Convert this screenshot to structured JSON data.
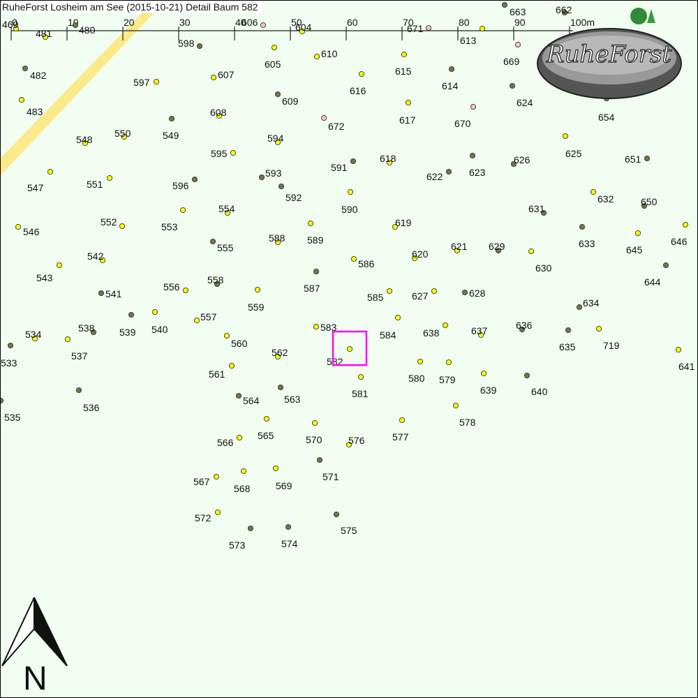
{
  "title": "RuheForst Losheim am See (2015-10-21) Detail  Baum 582",
  "selected_tree": "582",
  "logo_text": "RuheForst",
  "north_label": "N",
  "scale": {
    "labels": [
      "0",
      "10",
      "20",
      "30",
      "40",
      "50",
      "60",
      "70",
      "80",
      "90",
      "100m"
    ],
    "unit": "m",
    "max": 100
  },
  "colors": {
    "background": "#f0fdf0",
    "path": "#fbe98a",
    "tree_available": "#ffff00",
    "tree_occupied": "#757545",
    "tree_reserved": "#ffc0cb",
    "highlight": "#ff00ff"
  },
  "legend_meaning": {
    "available": "yellow",
    "occupied": "olive",
    "reserved": "pink"
  },
  "trees": [
    {
      "id": "469",
      "status": "available"
    },
    {
      "id": "481",
      "status": "available"
    },
    {
      "id": "480",
      "status": "occupied"
    },
    {
      "id": "482",
      "status": "occupied"
    },
    {
      "id": "483",
      "status": "available"
    },
    {
      "id": "598",
      "status": "occupied"
    },
    {
      "id": "606",
      "status": "reserved"
    },
    {
      "id": "604",
      "status": "available"
    },
    {
      "id": "605",
      "status": "available"
    },
    {
      "id": "610",
      "status": "available"
    },
    {
      "id": "607",
      "status": "available"
    },
    {
      "id": "597",
      "status": "available"
    },
    {
      "id": "609",
      "status": "occupied"
    },
    {
      "id": "608",
      "status": "available"
    },
    {
      "id": "672",
      "status": "reserved"
    },
    {
      "id": "671",
      "status": "reserved"
    },
    {
      "id": "613",
      "status": "available"
    },
    {
      "id": "663",
      "status": "occupied"
    },
    {
      "id": "662",
      "status": "occupied"
    },
    {
      "id": "669",
      "status": "reserved"
    },
    {
      "id": "615",
      "status": "available"
    },
    {
      "id": "616",
      "status": "available"
    },
    {
      "id": "614",
      "status": "occupied"
    },
    {
      "id": "624",
      "status": "occupied"
    },
    {
      "id": "617",
      "status": "available"
    },
    {
      "id": "670",
      "status": "reserved"
    },
    {
      "id": "654",
      "status": "occupied"
    },
    {
      "id": "549",
      "status": "occupied"
    },
    {
      "id": "550",
      "status": "available"
    },
    {
      "id": "548",
      "status": "available"
    },
    {
      "id": "595",
      "status": "available"
    },
    {
      "id": "594",
      "status": "available"
    },
    {
      "id": "547",
      "status": "available"
    },
    {
      "id": "551",
      "status": "available"
    },
    {
      "id": "596",
      "status": "occupied"
    },
    {
      "id": "593",
      "status": "occupied"
    },
    {
      "id": "591",
      "status": "occupied"
    },
    {
      "id": "618",
      "status": "available"
    },
    {
      "id": "622",
      "status": "occupied"
    },
    {
      "id": "623",
      "status": "occupied"
    },
    {
      "id": "626",
      "status": "occupied"
    },
    {
      "id": "625",
      "status": "available"
    },
    {
      "id": "651",
      "status": "occupied"
    },
    {
      "id": "592",
      "status": "occupied"
    },
    {
      "id": "590",
      "status": "available"
    },
    {
      "id": "632",
      "status": "available"
    },
    {
      "id": "650",
      "status": "occupied"
    },
    {
      "id": "554",
      "status": "available"
    },
    {
      "id": "553",
      "status": "available"
    },
    {
      "id": "552",
      "status": "available"
    },
    {
      "id": "546",
      "status": "available"
    },
    {
      "id": "589",
      "status": "available"
    },
    {
      "id": "588",
      "status": "available"
    },
    {
      "id": "555",
      "status": "occupied"
    },
    {
      "id": "619",
      "status": "available"
    },
    {
      "id": "631",
      "status": "occupied"
    },
    {
      "id": "633",
      "status": "occupied"
    },
    {
      "id": "645",
      "status": "available"
    },
    {
      "id": "646",
      "status": "available"
    },
    {
      "id": "542",
      "status": "available"
    },
    {
      "id": "543",
      "status": "available"
    },
    {
      "id": "586",
      "status": "available"
    },
    {
      "id": "620",
      "status": "available"
    },
    {
      "id": "621",
      "status": "available"
    },
    {
      "id": "629",
      "status": "occupied"
    },
    {
      "id": "630",
      "status": "available"
    },
    {
      "id": "587",
      "status": "occupied"
    },
    {
      "id": "558",
      "status": "occupied"
    },
    {
      "id": "556",
      "status": "available"
    },
    {
      "id": "541",
      "status": "occupied"
    },
    {
      "id": "644",
      "status": "occupied"
    },
    {
      "id": "559",
      "status": "available"
    },
    {
      "id": "585",
      "status": "available"
    },
    {
      "id": "627",
      "status": "available"
    },
    {
      "id": "628",
      "status": "occupied"
    },
    {
      "id": "634",
      "status": "occupied"
    },
    {
      "id": "557",
      "status": "available"
    },
    {
      "id": "538",
      "status": "occupied"
    },
    {
      "id": "539",
      "status": "occupied"
    },
    {
      "id": "540",
      "status": "available"
    },
    {
      "id": "583",
      "status": "available"
    },
    {
      "id": "584",
      "status": "available"
    },
    {
      "id": "638",
      "status": "available"
    },
    {
      "id": "637",
      "status": "available"
    },
    {
      "id": "636",
      "status": "occupied"
    },
    {
      "id": "635",
      "status": "occupied"
    },
    {
      "id": "719",
      "status": "available"
    },
    {
      "id": "534",
      "status": "available"
    },
    {
      "id": "537",
      "status": "available"
    },
    {
      "id": "560",
      "status": "available"
    },
    {
      "id": "562",
      "status": "available"
    },
    {
      "id": "582",
      "status": "available"
    },
    {
      "id": "533",
      "status": "occupied"
    },
    {
      "id": "641",
      "status": "available"
    },
    {
      "id": "561",
      "status": "available"
    },
    {
      "id": "580",
      "status": "available"
    },
    {
      "id": "579",
      "status": "available"
    },
    {
      "id": "581",
      "status": "available"
    },
    {
      "id": "639",
      "status": "available"
    },
    {
      "id": "640",
      "status": "occupied"
    },
    {
      "id": "536",
      "status": "occupied"
    },
    {
      "id": "564",
      "status": "occupied"
    },
    {
      "id": "563",
      "status": "occupied"
    },
    {
      "id": "535",
      "status": "occupied"
    },
    {
      "id": "578",
      "status": "available"
    },
    {
      "id": "565",
      "status": "available"
    },
    {
      "id": "570",
      "status": "available"
    },
    {
      "id": "577",
      "status": "available"
    },
    {
      "id": "566",
      "status": "available"
    },
    {
      "id": "576",
      "status": "available"
    },
    {
      "id": "571",
      "status": "occupied"
    },
    {
      "id": "567",
      "status": "available"
    },
    {
      "id": "568",
      "status": "available"
    },
    {
      "id": "569",
      "status": "available"
    },
    {
      "id": "572",
      "status": "available"
    },
    {
      "id": "575",
      "status": "occupied"
    },
    {
      "id": "573",
      "status": "occupied"
    },
    {
      "id": "574",
      "status": "occupied"
    }
  ]
}
